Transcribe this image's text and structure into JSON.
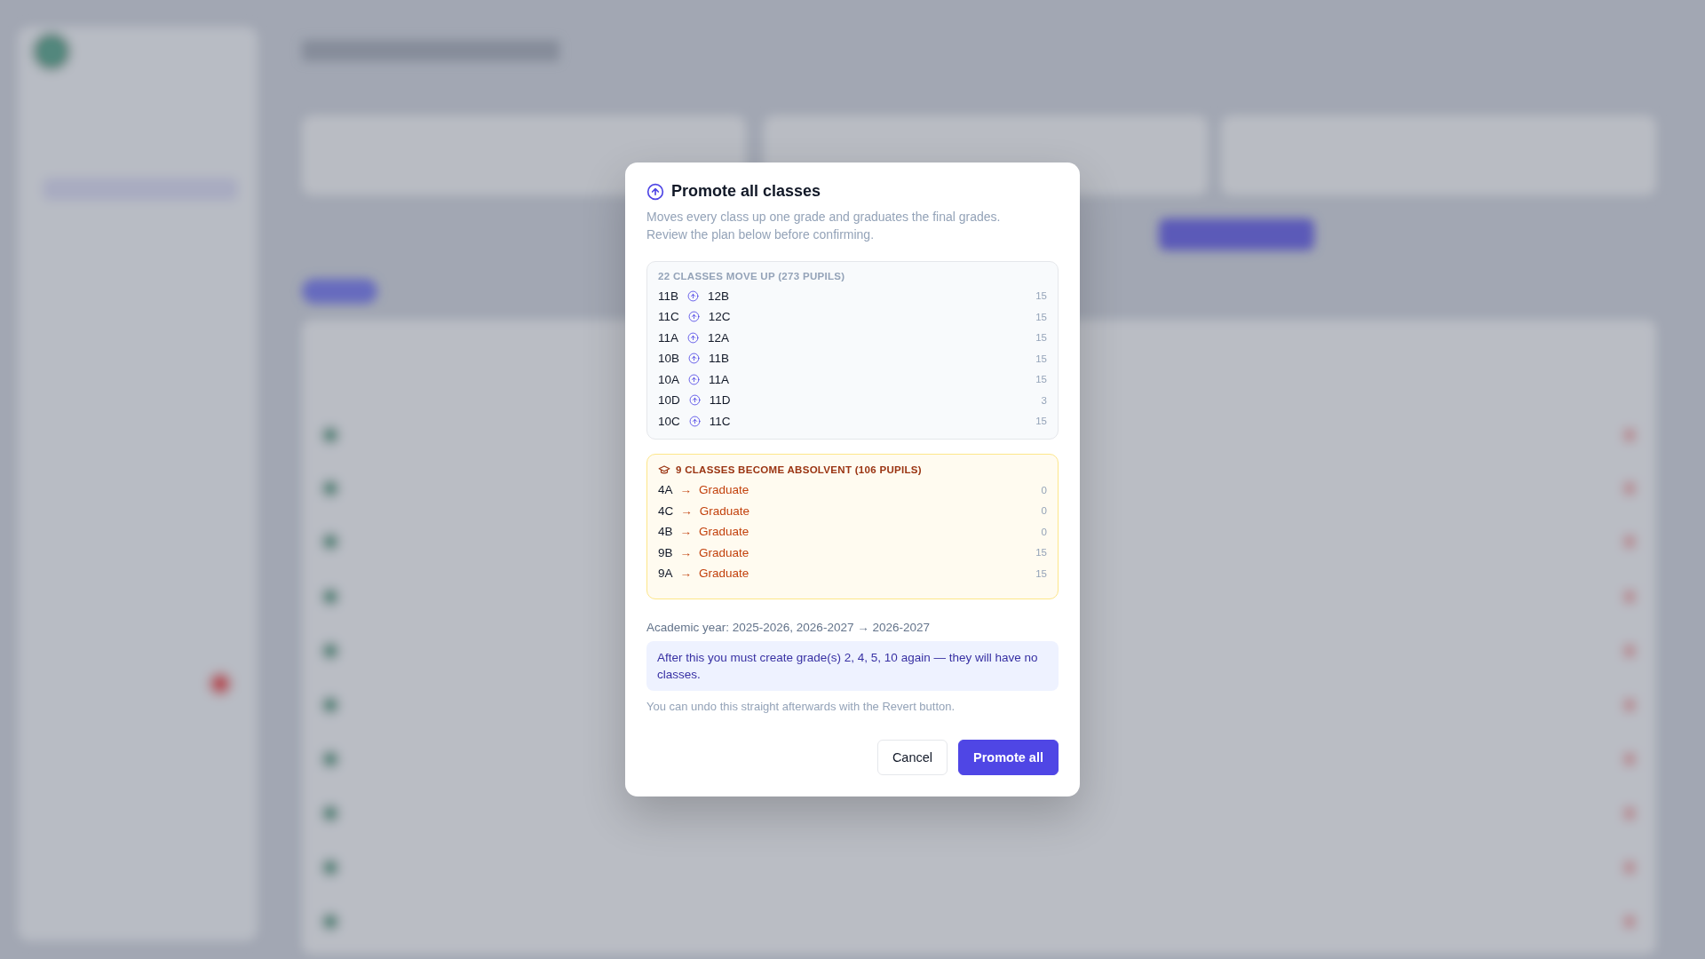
{
  "dialog": {
    "title": "Promote all classes",
    "description": "Moves every class up one grade and graduates the final grades. Review the plan below before confirming.",
    "promotions": {
      "heading": "22 CLASSES MOVE UP (273 PUPILS)",
      "rows": [
        {
          "from": "11B",
          "to": "12B",
          "count": "15"
        },
        {
          "from": "11C",
          "to": "12C",
          "count": "15"
        },
        {
          "from": "11A",
          "to": "12A",
          "count": "15"
        },
        {
          "from": "10B",
          "to": "11B",
          "count": "15"
        },
        {
          "from": "10A",
          "to": "11A",
          "count": "15"
        },
        {
          "from": "10D",
          "to": "11D",
          "count": "3"
        },
        {
          "from": "10C",
          "to": "11C",
          "count": "15"
        }
      ]
    },
    "graduations": {
      "heading": "9 CLASSES BECOME ABSOLVENT (106 PUPILS)",
      "rows": [
        {
          "from": "4A",
          "arrow": "→",
          "to": "Graduate",
          "count": "0"
        },
        {
          "from": "4C",
          "arrow": "→",
          "to": "Graduate",
          "count": "0"
        },
        {
          "from": "4B",
          "arrow": "→",
          "to": "Graduate",
          "count": "0"
        },
        {
          "from": "9B",
          "arrow": "→",
          "to": "Graduate",
          "count": "15"
        },
        {
          "from": "9A",
          "arrow": "→",
          "to": "Graduate",
          "count": "15"
        }
      ]
    },
    "academic_year": "Academic year: 2025-2026, 2026-2027 → 2026-2027",
    "notice": "After this you must create grade(s) 2, 4, 5, 10 again — they will have no classes.",
    "undo_note": "You can undo this straight afterwards with the Revert button.",
    "buttons": [
      {
        "label": "Cancel",
        "kind": "secondary"
      },
      {
        "label": "Promote all",
        "kind": "primary"
      }
    ]
  }
}
